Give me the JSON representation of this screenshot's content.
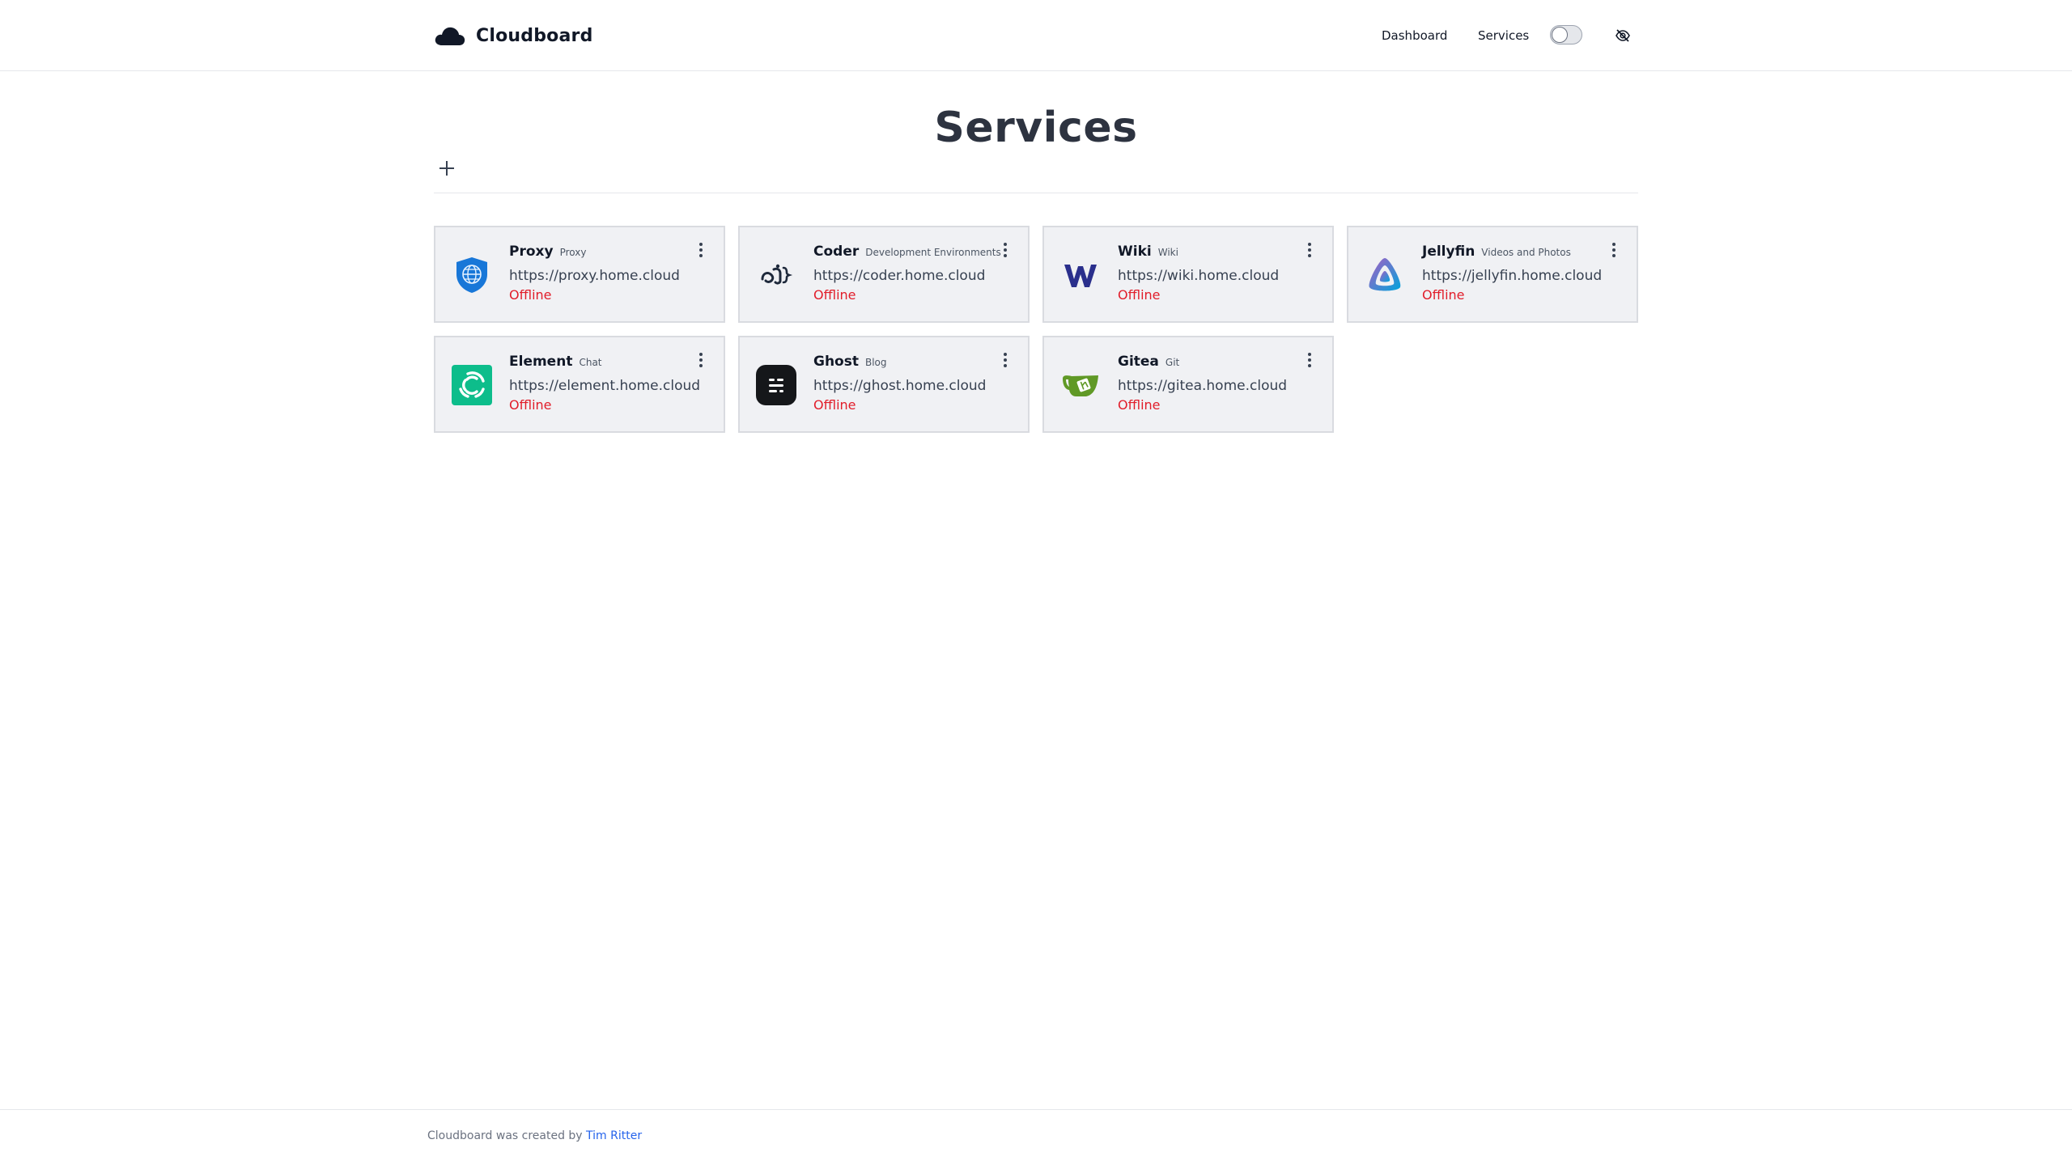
{
  "header": {
    "brand": "Cloudboard",
    "nav": {
      "dashboard": "Dashboard",
      "services": "Services"
    },
    "theme_toggle": {
      "state": "off",
      "icon": "toggle-icon"
    },
    "visibility_icon": "eye-off-icon"
  },
  "main": {
    "title": "Services",
    "add_icon": "plus-icon"
  },
  "services": [
    {
      "name": "Proxy",
      "category": "Proxy",
      "url": "https://proxy.home.cloud",
      "status": "Offline",
      "icon": "globe-shield-icon"
    },
    {
      "name": "Coder",
      "category": "Development Environments",
      "url": "https://coder.home.cloud",
      "status": "Offline",
      "icon": "coder-icon"
    },
    {
      "name": "Wiki",
      "category": "Wiki",
      "url": "https://wiki.home.cloud",
      "status": "Offline",
      "icon": "wiki-w-icon"
    },
    {
      "name": "Jellyfin",
      "category": "Videos and Photos",
      "url": "https://jellyfin.home.cloud",
      "status": "Offline",
      "icon": "jellyfin-icon"
    },
    {
      "name": "Element",
      "category": "Chat",
      "url": "https://element.home.cloud",
      "status": "Offline",
      "icon": "element-icon"
    },
    {
      "name": "Ghost",
      "category": "Blog",
      "url": "https://ghost.home.cloud",
      "status": "Offline",
      "icon": "ghost-icon"
    },
    {
      "name": "Gitea",
      "category": "Git",
      "url": "https://gitea.home.cloud",
      "status": "Offline",
      "icon": "gitea-teacup-icon"
    }
  ],
  "footer": {
    "text": "Cloudboard was created by ",
    "author": "Tim Ritter"
  },
  "colors": {
    "offline": "#e11d2a",
    "card_bg": "#f0f1f4",
    "link": "#2563eb"
  }
}
